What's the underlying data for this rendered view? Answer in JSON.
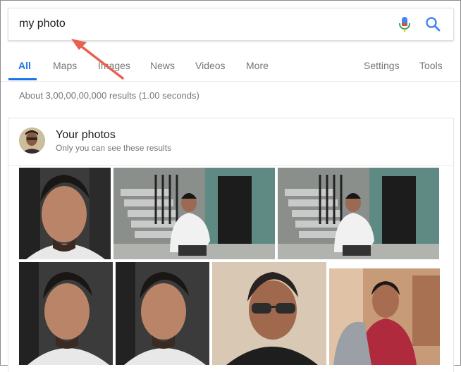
{
  "search": {
    "query": "my photo",
    "mic_icon": "microphone-icon",
    "search_icon": "search-icon"
  },
  "tabs": {
    "items": [
      {
        "label": "All",
        "active": true
      },
      {
        "label": "Maps",
        "active": false
      },
      {
        "label": "Images",
        "active": false
      },
      {
        "label": "News",
        "active": false
      },
      {
        "label": "Videos",
        "active": false
      },
      {
        "label": "More",
        "active": false
      }
    ],
    "settings": "Settings",
    "tools": "Tools"
  },
  "results": {
    "stats": "About 3,00,00,00,000 results (1.00 seconds)"
  },
  "photos_card": {
    "title": "Your photos",
    "subtitle": "Only you can see these results",
    "photos": [
      "photo-closeup-1",
      "photo-stairs-1",
      "photo-stairs-2",
      "photo-closeup-2",
      "photo-closeup-3",
      "photo-sunglasses",
      "photo-jacket"
    ]
  },
  "colors": {
    "accent": "#1a73e8",
    "annotation": "#e8604e"
  }
}
